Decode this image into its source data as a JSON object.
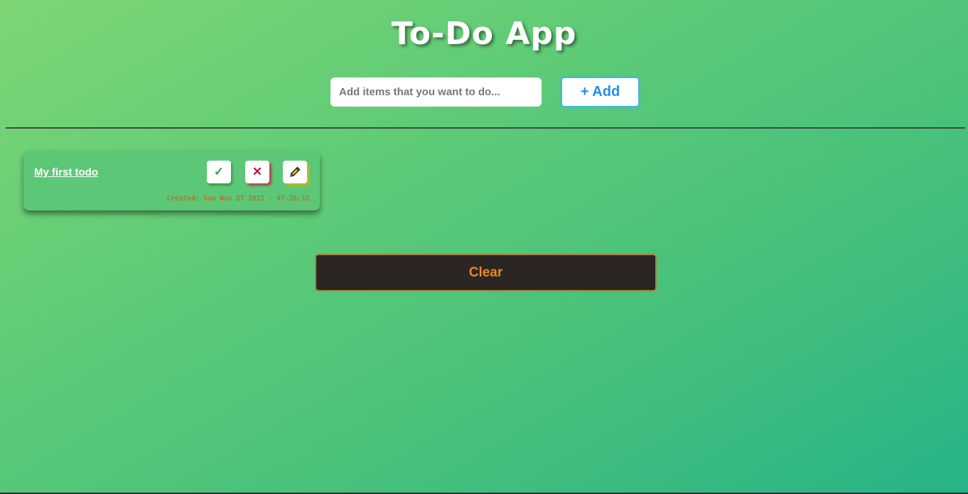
{
  "app": {
    "title": "To-Do App"
  },
  "add_form": {
    "placeholder": "Add items that you want to do...",
    "value": "",
    "add_label": "+ Add"
  },
  "todos": [
    {
      "text": "My first todo",
      "created": "Created: Sun Nov 27 2022 - 07:26:32",
      "icons": {
        "complete": "check-icon",
        "delete": "close-icon",
        "edit": "pencil-icon"
      },
      "icon_glyphs": {
        "complete": "✓",
        "delete": "✕"
      }
    }
  ],
  "clear_label": "Clear",
  "colors": {
    "gradient_start": "#7cd676",
    "gradient_end": "#27b386",
    "add_accent": "#1e8fe6",
    "check": "#3aa33a",
    "delete": "#c31439",
    "edit": "#d9a400",
    "clear_text": "#e88a1f",
    "clear_bg": "#2b2623"
  }
}
